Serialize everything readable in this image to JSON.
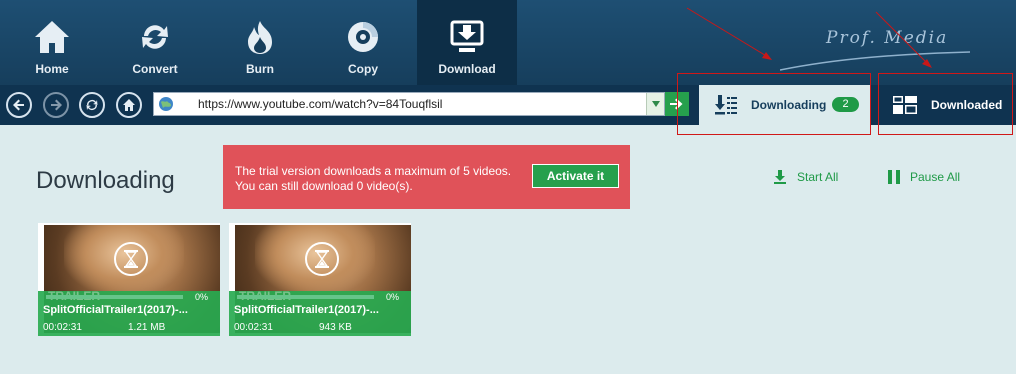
{
  "toolbar": {
    "items": [
      {
        "label": "Home",
        "icon": "home-icon"
      },
      {
        "label": "Convert",
        "icon": "convert-icon"
      },
      {
        "label": "Burn",
        "icon": "burn-icon"
      },
      {
        "label": "Copy",
        "icon": "copy-icon"
      },
      {
        "label": "Download",
        "icon": "download-icon",
        "active": true
      }
    ]
  },
  "brand": {
    "text": "Prof. Media"
  },
  "address": {
    "url": "https://www.youtube.com/watch?v=84Touqflsil"
  },
  "tabs": {
    "downloading_label": "Downloading",
    "downloading_count": "2",
    "downloaded_label": "Downloaded"
  },
  "main": {
    "title": "Downloading",
    "trial_message": "The trial version downloads a maximum of 5 videos. You can still download 0 video(s).",
    "activate_label": "Activate it",
    "start_all_label": "Start All",
    "pause_all_label": "Pause All"
  },
  "items": [
    {
      "name": "SplitOfficialTrailer1(2017)-...",
      "progress": "0%",
      "duration": "00:02:31",
      "size": "1.21 MB",
      "watermark": "TRAILER"
    },
    {
      "name": "SplitOfficialTrailer1(2017)-...",
      "progress": "0%",
      "duration": "00:02:31",
      "size": "943 KB",
      "watermark": "TRAILER"
    }
  ],
  "colors": {
    "accent_green": "#26a04d",
    "toolbar_blue": "#1e4f73",
    "alert_red": "#e05259"
  }
}
